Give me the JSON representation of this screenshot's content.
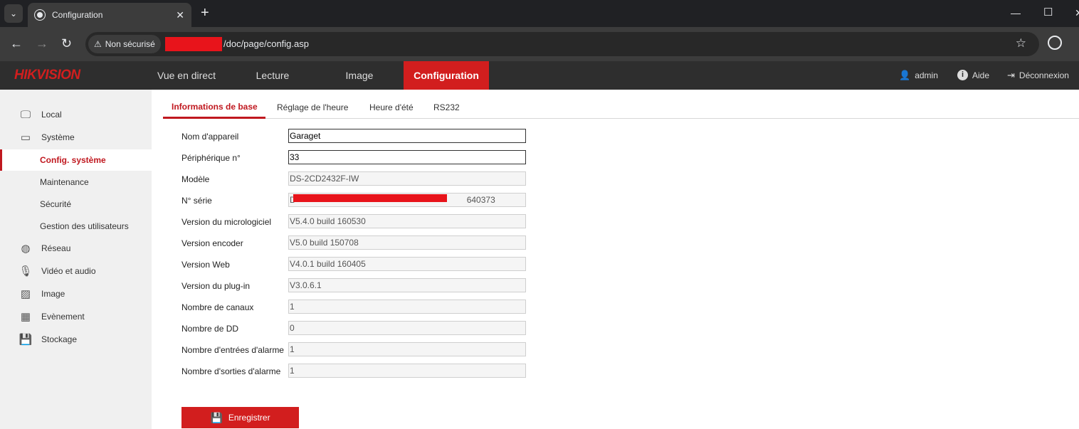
{
  "browser": {
    "tab_title": "Configuration",
    "tab_close": "✕",
    "new_tab": "+",
    "security_label": "Non sécurisé",
    "url_path": "/doc/page/config.asp"
  },
  "header": {
    "brand": "HIKVISION",
    "nav": [
      "Vue en direct",
      "Lecture",
      "Image",
      "Configuration"
    ],
    "active_nav": "Configuration",
    "user": "admin",
    "help": "Aide",
    "logout": "Déconnexion"
  },
  "sidebar": {
    "items": [
      {
        "label": "Local",
        "icon": "monitor-icon"
      },
      {
        "label": "Système",
        "icon": "window-icon"
      },
      {
        "label": "Config. système",
        "sub": true,
        "active": true
      },
      {
        "label": "Maintenance",
        "sub": true
      },
      {
        "label": "Sécurité",
        "sub": true
      },
      {
        "label": "Gestion des utilisateurs",
        "sub": true
      },
      {
        "label": "Réseau",
        "icon": "globe-icon"
      },
      {
        "label": "Vidéo et audio",
        "icon": "microphone-icon"
      },
      {
        "label": "Image",
        "icon": "image-icon"
      },
      {
        "label": "Evènement",
        "icon": "calendar-icon"
      },
      {
        "label": "Stockage",
        "icon": "floppy-icon"
      }
    ]
  },
  "subtabs": [
    "Informations de base",
    "Réglage de l'heure",
    "Heure d'été",
    "RS232"
  ],
  "form": {
    "fields": [
      {
        "label": "Nom d'appareil",
        "value": "Garaget",
        "editable": true
      },
      {
        "label": "Périphérique n°",
        "value": "33",
        "editable": true
      },
      {
        "label": "Modèle",
        "value": "DS-2CD2432F-IW",
        "editable": false
      },
      {
        "label": "N° série",
        "value": "D                                                                        640373",
        "editable": false
      },
      {
        "label": "Version du micrologiciel",
        "value": "V5.4.0 build 160530",
        "editable": false
      },
      {
        "label": "Version encoder",
        "value": "V5.0 build 150708",
        "editable": false
      },
      {
        "label": "Version Web",
        "value": "V4.0.1 build 160405",
        "editable": false
      },
      {
        "label": "Version du plug-in",
        "value": "V3.0.6.1",
        "editable": false
      },
      {
        "label": "Nombre de canaux",
        "value": "1",
        "editable": false
      },
      {
        "label": "Nombre de DD",
        "value": "0",
        "editable": false
      },
      {
        "label": "Nombre d'entrées d'alarme",
        "value": "1",
        "editable": false
      },
      {
        "label": "Nombre d'sorties d'alarme",
        "value": "1",
        "editable": false
      }
    ],
    "save_label": "Enregistrer"
  },
  "colors": {
    "accent": "#d21e1e",
    "header_bg": "#2e2e2e",
    "sidebar_bg": "#f0f0f0"
  }
}
